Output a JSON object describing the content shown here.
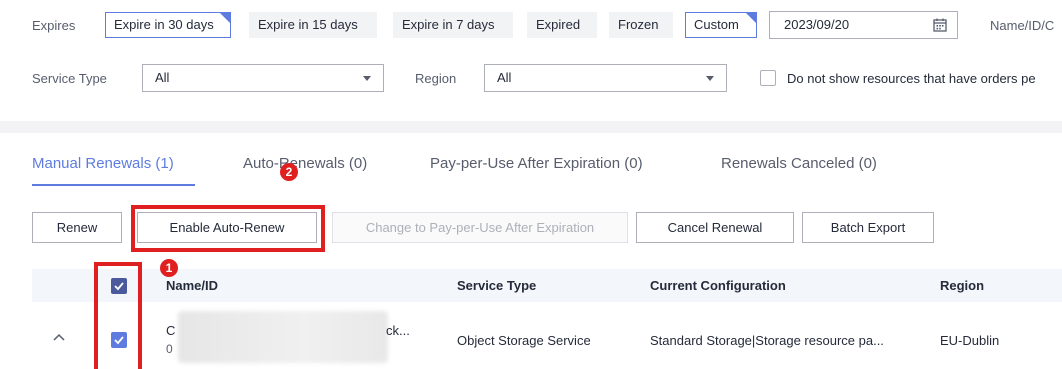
{
  "filters": {
    "expires_label": "Expires",
    "expires_options": [
      "Expire in 30 days",
      "Expire in 15 days",
      "Expire in 7 days",
      "Expired",
      "Frozen",
      "Custom"
    ],
    "selected_expires": [
      "Expire in 30 days",
      "Custom"
    ],
    "date_value": "2023/09/20",
    "name_label": "Name/ID/C",
    "service_type_label": "Service Type",
    "service_type_value": "All",
    "region_label": "Region",
    "region_value": "All",
    "hide_orders_checkbox_label": "Do not show resources that have orders pe",
    "hide_orders_checked": false
  },
  "tabs": [
    {
      "label": "Manual Renewals (1)",
      "active": true
    },
    {
      "label": "Auto-Renewals (0)",
      "active": false
    },
    {
      "label": "Pay-per-Use After Expiration (0)",
      "active": false
    },
    {
      "label": "Renewals Canceled (0)",
      "active": false
    }
  ],
  "actions": {
    "renew": "Renew",
    "enable_auto_renew": "Enable Auto-Renew",
    "change_pay_per_use": "Change to Pay-per-Use After Expiration",
    "cancel_renewal": "Cancel Renewal",
    "batch_export": "Batch Export"
  },
  "table": {
    "columns": [
      "Name/ID",
      "Service Type",
      "Current Configuration",
      "Region"
    ],
    "rows": [
      {
        "name_line1": "C",
        "name_line1_end": "ck...",
        "name_line2": "0",
        "service_type": "Object Storage Service",
        "configuration": "Standard Storage|Storage resource pa...",
        "region": "EU-Dublin",
        "selected": true
      }
    ]
  },
  "annotations": {
    "step1": "1",
    "step2": "2"
  },
  "colors": {
    "accent": "#5e7ce0",
    "annotation_red": "#e02020",
    "header_bg": "#f3f6fa"
  }
}
